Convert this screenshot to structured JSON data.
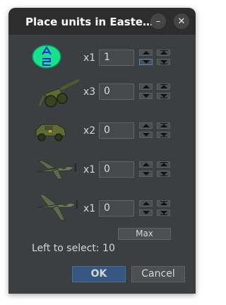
{
  "window": {
    "title": "Place units in Easte…",
    "minimize_icon": "minimize-icon",
    "close_icon": "close-icon"
  },
  "units": [
    {
      "icon": "aa-gun-token-icon",
      "multiplier": "x1",
      "quantity": "1"
    },
    {
      "icon": "artillery-icon",
      "multiplier": "x3",
      "quantity": "0"
    },
    {
      "icon": "armored-car-icon",
      "multiplier": "x2",
      "quantity": "0"
    },
    {
      "icon": "fighter-plane-icon",
      "multiplier": "x1",
      "quantity": "0"
    },
    {
      "icon": "tactical-bomber-icon",
      "multiplier": "x1",
      "quantity": "0"
    }
  ],
  "max_label": "Max",
  "left_to_select": "Left to select: 10",
  "buttons": {
    "ok": "OK",
    "cancel": "Cancel"
  },
  "colors": {
    "accent": "#365880",
    "dialog_bg": "#3c3f41",
    "titlebar_bg": "#2d2d2d"
  }
}
